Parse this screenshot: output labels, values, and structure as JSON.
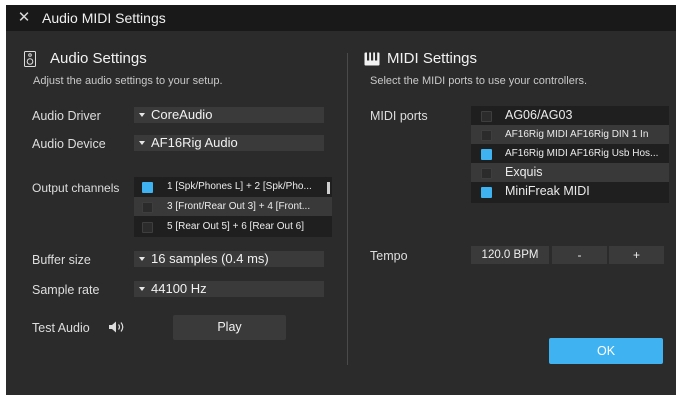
{
  "window": {
    "title": "Audio MIDI Settings",
    "close_glyph": "✕"
  },
  "audio": {
    "title": "Audio Settings",
    "description": "Adjust the audio settings to your setup.",
    "driver": {
      "label": "Audio Driver",
      "value": "CoreAudio"
    },
    "device": {
      "label": "Audio Device",
      "value": "AF16Rig Audio"
    },
    "output_channels": {
      "label": "Output channels",
      "items": [
        {
          "label": "1 [Spk/Phones L] + 2 [Spk/Pho...",
          "checked": true
        },
        {
          "label": "3 [Front/Rear Out 3] + 4 [Front...",
          "checked": false
        },
        {
          "label": "5 [Rear Out 5] + 6 [Rear Out 6]",
          "checked": false
        }
      ]
    },
    "buffer": {
      "label": "Buffer size",
      "value": "16 samples (0.4 ms)"
    },
    "sample_rate": {
      "label": "Sample rate",
      "value": "44100 Hz"
    },
    "test": {
      "label": "Test Audio",
      "play_label": "Play"
    }
  },
  "midi": {
    "title": "MIDI Settings",
    "description": "Select the MIDI ports to use your controllers.",
    "ports": {
      "label": "MIDI ports",
      "items": [
        {
          "label": "AG06/AG03",
          "checked": false
        },
        {
          "label": "AF16Rig MIDI AF16Rig DIN 1 In",
          "checked": false
        },
        {
          "label": "AF16Rig MIDI AF16Rig Usb Hos...",
          "checked": true
        },
        {
          "label": "Exquis",
          "checked": false
        },
        {
          "label": "MiniFreak MIDI",
          "checked": true
        }
      ]
    },
    "tempo": {
      "label": "Tempo",
      "value": "120.0 BPM",
      "minus": "-",
      "plus": "+"
    }
  },
  "ok_label": "OK",
  "colors": {
    "accent": "#3fb3f2",
    "panel": "#2b2b2b",
    "titlebar": "#191919"
  }
}
